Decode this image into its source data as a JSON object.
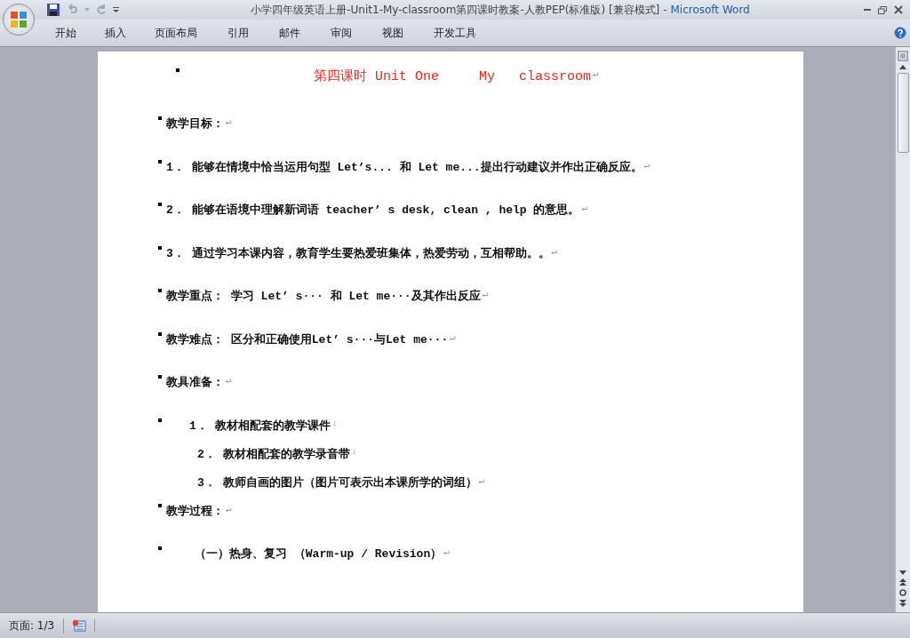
{
  "window": {
    "title": "小学四年级英语上册-Unit1-My-classroom第四课时教案-人教PEP(标准版) [兼容模式]",
    "app_name": "- Microsoft Word"
  },
  "ribbon_tabs": [
    "开始",
    "插入",
    "页面布局",
    "引用",
    "邮件",
    "审阅",
    "视图",
    "开发工具"
  ],
  "document": {
    "paragraphs": [
      {
        "kind": "title",
        "text": "第四课时 Unit One     My   classroom",
        "mark": "↵"
      },
      {
        "kind": "heading",
        "text": "教学目标：",
        "mark": "↵"
      },
      {
        "kind": "body",
        "text": "1． 能够在情境中恰当运用句型 Let’s... 和 Let me...提出行动建议并作出正确反应。",
        "mark": "↵"
      },
      {
        "kind": "body",
        "text": "2． 能够在语境中理解新词语 teacher’ s desk, clean , help 的意思。",
        "mark": "↵"
      },
      {
        "kind": "body",
        "text": "3． 通过学习本课内容，教育学生要热爱班集体，热爱劳动，互相帮助。。",
        "mark": "↵"
      },
      {
        "kind": "body",
        "text": "教学重点： 学习 Let’ s··· 和 Let me···及其作出反应",
        "mark": "↵"
      },
      {
        "kind": "body",
        "text": "教学难点： 区分和正确使用Let’ s···与Let me···",
        "mark": "↵"
      },
      {
        "kind": "heading",
        "text": "教具准备：",
        "mark": "↵"
      },
      {
        "kind": "list",
        "text": "1． 教材相配套的教学课件",
        "mark": "↓"
      },
      {
        "kind": "sublist",
        "text": "2． 教材相配套的教学录音带",
        "mark": "↓"
      },
      {
        "kind": "sublist",
        "text": "3． 教师自画的图片（图片可表示出本课所学的词组）",
        "mark": "↵"
      },
      {
        "kind": "heading",
        "text": "教学过程：",
        "mark": "↵"
      },
      {
        "kind": "section",
        "text": "（一）热身、复习 （Warm-up / Revision）",
        "mark": "↵"
      }
    ]
  },
  "status_bar": {
    "page": "页面: 1/3"
  }
}
